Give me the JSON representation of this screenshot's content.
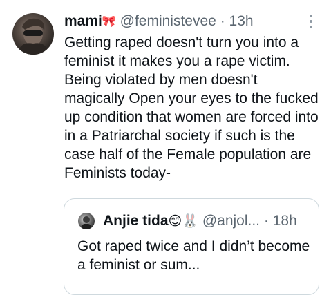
{
  "tweet": {
    "display_name": "mami",
    "name_emoji": "🎀",
    "handle": "@feministevee",
    "separator": "·",
    "time": "13h",
    "text": "Getting raped doesn't turn you into a feminist it makes you a rape victim. Being violated by men doesn't magically Open your eyes to the fucked up condition that women are forced into in a Patriarchal society if such is the case half of the Female population are Feminists today-"
  },
  "quoted_tweet": {
    "display_name": "Anjie tida",
    "emojis": "😊🐰",
    "handle": "@anjol...",
    "separator": "·",
    "time": "18h",
    "text": "Got raped twice and I didn’t become a feminist or sum..."
  },
  "icons": {
    "menu": "more-vertical-icon"
  }
}
